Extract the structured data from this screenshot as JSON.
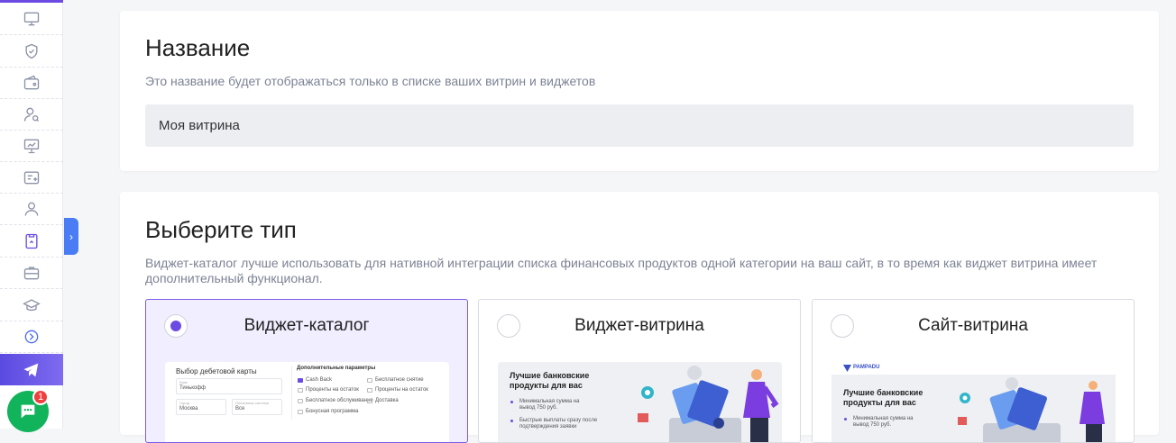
{
  "sidebar": {
    "items": [
      {
        "icon": "monitor-icon"
      },
      {
        "icon": "shield-check-icon"
      },
      {
        "icon": "wallet-icon"
      },
      {
        "icon": "user-search-icon"
      },
      {
        "icon": "presentation-chart-icon"
      },
      {
        "icon": "list-add-icon"
      },
      {
        "icon": "user-icon"
      },
      {
        "icon": "widget-icon",
        "active": true
      },
      {
        "icon": "briefcase-icon"
      },
      {
        "icon": "graduation-cap-icon"
      },
      {
        "icon": "circle-chevron-icon"
      },
      {
        "icon": "telegram-icon"
      }
    ],
    "chat_badge": "1",
    "accent": "#6c4be3"
  },
  "name_section": {
    "title": "Название",
    "subtitle": "Это название будет отображаться только в списке ваших витрин и виджетов",
    "input_value": "Моя витрина"
  },
  "type_section": {
    "title": "Выберите тип",
    "subtitle": "Виджет-каталог лучше использовать для нативной интеграции списка финансовых продуктов одной категории на ваш сайт, в то время как виджет витрина имеет дополнительный функционал.",
    "options": [
      {
        "label": "Виджет-каталог",
        "selected": true,
        "preview": {
          "heading": "Выбор дебетовой карты",
          "params_heading": "Дополнительные параметры",
          "bank_label": "Банк",
          "bank_value": "Тинькофф",
          "city_label": "Город",
          "city_value": "Москва",
          "system_label": "Платежная система",
          "system_value": "Все",
          "checks_left": [
            "Cash Back",
            "Проценты на остаток",
            "Бесплатное обслуживание",
            "Бонусная программа"
          ],
          "checks_right": [
            "Бесплатное снятие",
            "Проценты на остаток",
            "Доставка"
          ]
        }
      },
      {
        "label": "Виджет-витрина",
        "selected": false,
        "preview": {
          "heading": "Лучшие банковские продукты для вас",
          "bullet1": "Минимальная сумма на вывод 750 руб.",
          "bullet2": "Быстрые выплаты сразу после подтверждения заявки"
        }
      },
      {
        "label": "Сайт-витрина",
        "selected": false,
        "preview": {
          "logo": "PAMPADU",
          "heading": "Лучшие банковские продукты для вас",
          "bullet1": "Минимальная сумма на вывод 750 руб."
        }
      }
    ]
  }
}
